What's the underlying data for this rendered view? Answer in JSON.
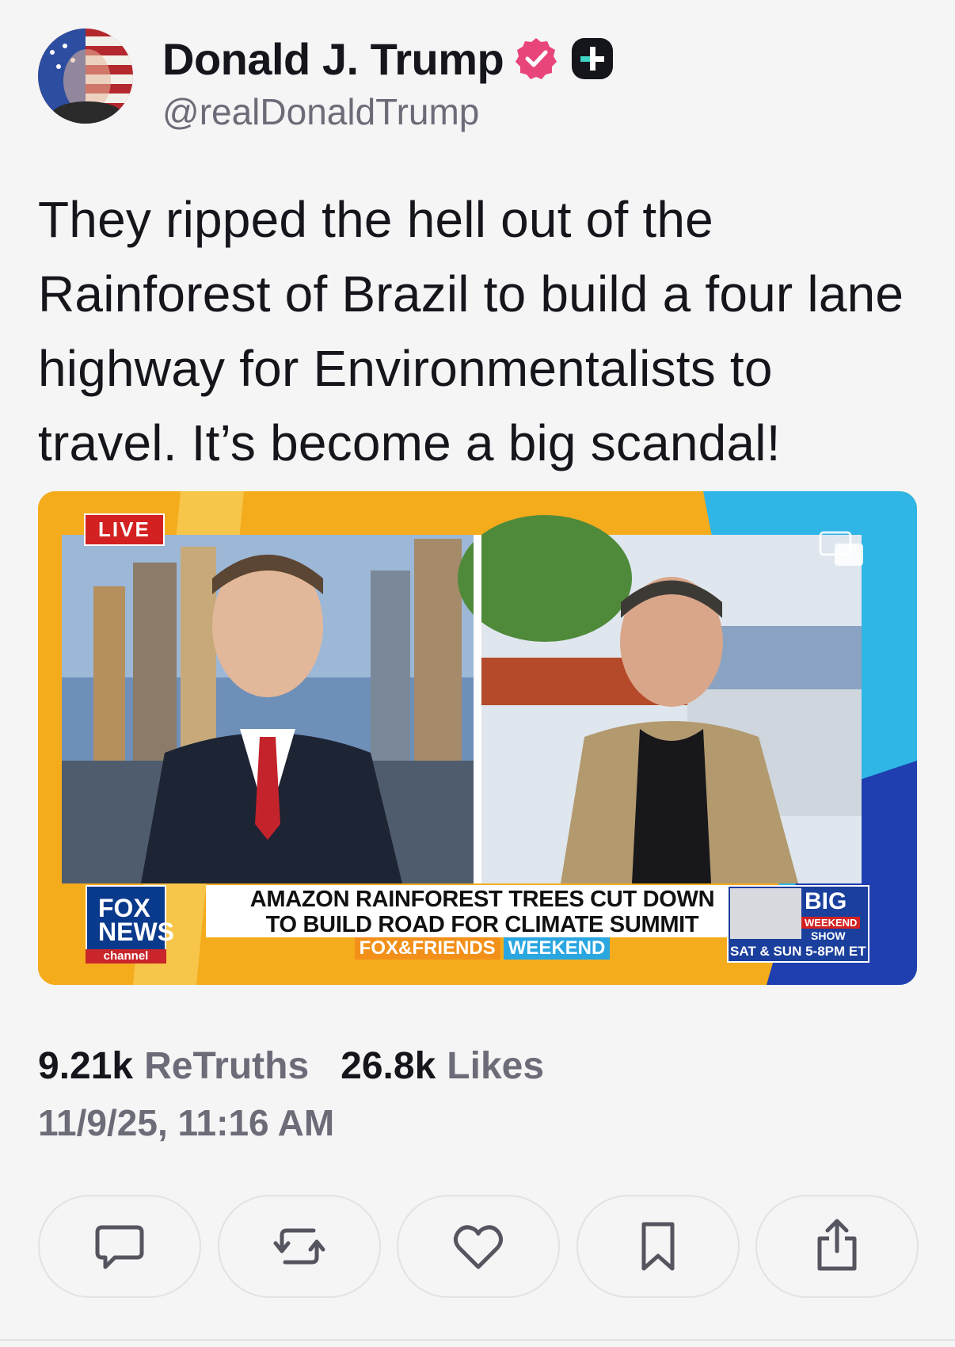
{
  "post": {
    "author": {
      "display_name": "Donald J. Trump",
      "handle": "@realDonaldTrump",
      "verified_icon": "verified-badge-icon",
      "plus_icon": "plus-badge-icon",
      "accent_color": "#e8457a"
    },
    "text": "They ripped the hell out of the Rainforest of Brazil to build a four lane highway for Environmentalists to travel. It’s become a big scandal!",
    "media": {
      "live_label": "LIVE",
      "headline_line1": "AMAZON RAINFOREST TREES CUT DOWN",
      "headline_line2": "TO BUILD ROAD FOR CLIMATE SUMMIT",
      "show_part1": "FOX&FRIENDS",
      "show_part2": "WEEKEND",
      "network_line1": "FOX",
      "network_line2": "NEWS",
      "network_channel": "channel",
      "promo_big": "BIG",
      "promo_weekend": "WEEKEND",
      "promo_show": "SHOW",
      "promo_time": "SAT & SUN 5-8PM ET"
    },
    "stats": {
      "retruths_count": "9.21k",
      "retruths_label": "ReTruths",
      "likes_count": "26.8k",
      "likes_label": "Likes"
    },
    "timestamp": "11/9/25, 11:16 AM",
    "actions": {
      "icons": [
        "comment-icon",
        "retruth-icon",
        "like-icon",
        "bookmark-icon",
        "share-icon"
      ]
    }
  }
}
